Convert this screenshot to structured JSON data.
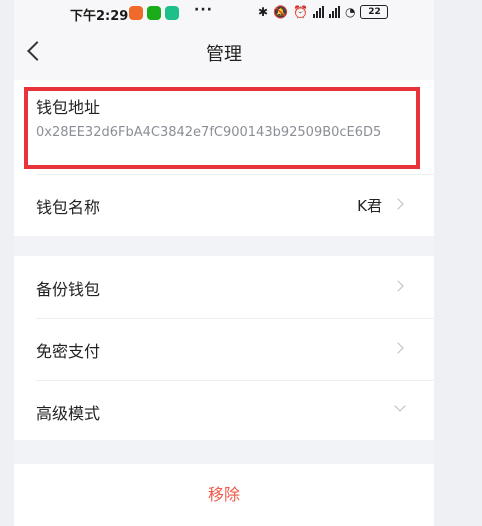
{
  "status_bar": {
    "time": "下午2:29",
    "more": "···",
    "battery": "22"
  },
  "nav": {
    "title": "管理"
  },
  "wallet": {
    "address_label": "钱包地址",
    "address": "0x28EE32d6FbA4C3842e7fC900143b92509B0cE6D5",
    "name_label": "钱包名称",
    "name_value": "K君"
  },
  "menu": {
    "backup_label": "备份钱包",
    "password_free_label": "免密支付",
    "advanced_label": "高级模式"
  },
  "actions": {
    "remove_label": "移除"
  },
  "colors": {
    "highlight_border": "#e8333a",
    "danger_text": "#ee5a4a",
    "app_icons": [
      "#f06a2a",
      "#1aad19",
      "#1ec08a"
    ]
  }
}
